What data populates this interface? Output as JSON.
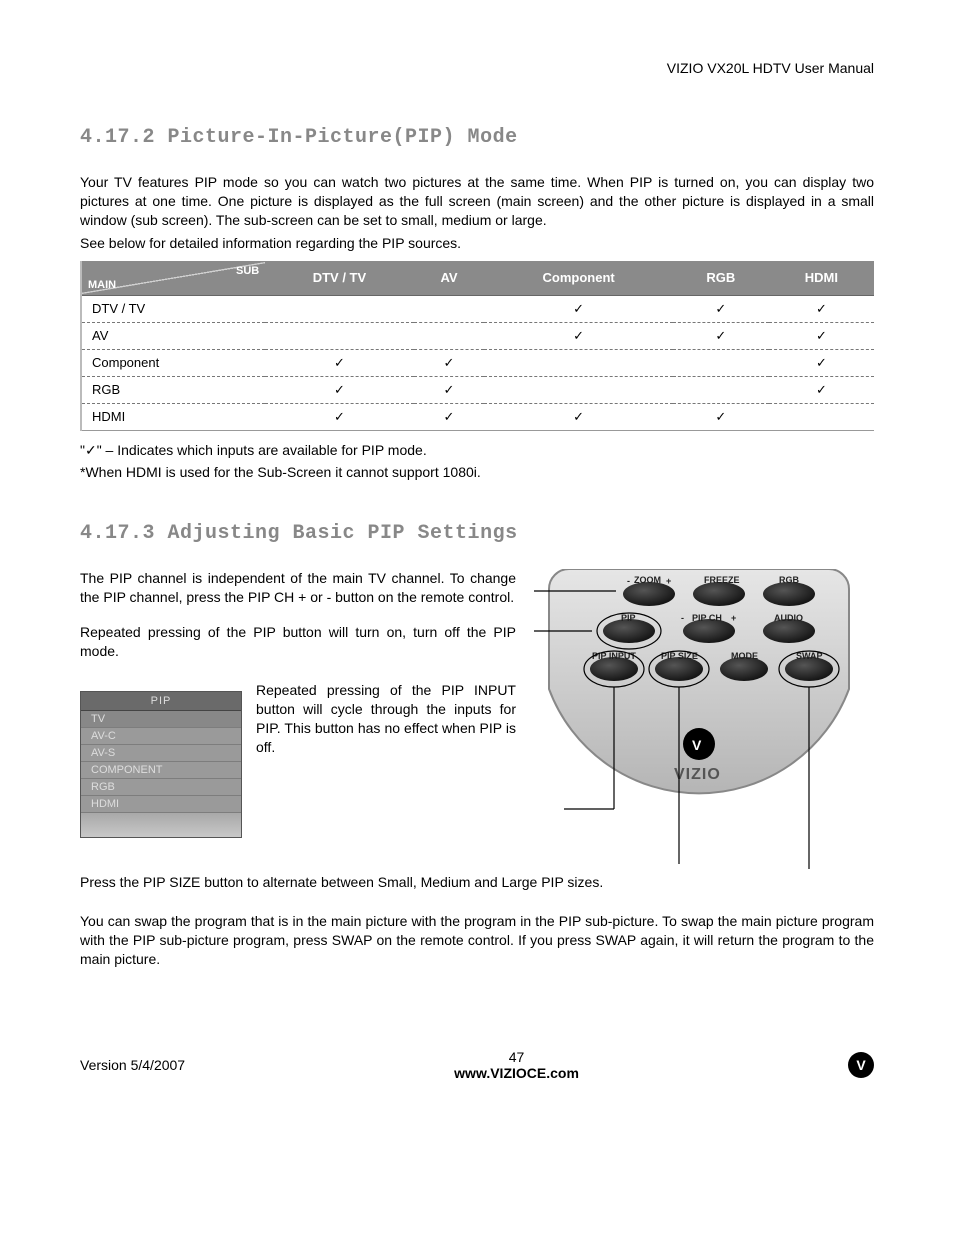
{
  "header": {
    "title": "VIZIO VX20L HDTV User Manual"
  },
  "s1": {
    "heading": "4.17.2 Picture-In-Picture(PIP) Mode",
    "p1": "Your TV features PIP mode so you can watch two pictures at the same time. When PIP is turned on, you can display two pictures at one time. One picture is displayed as the full screen (main screen) and the other picture is displayed in a small window (sub screen). The sub-screen can be set to small, medium or large.",
    "p2": "See below for detailed information regarding the PIP sources.",
    "note1": "\"✓\" – Indicates which inputs are available for PIP mode.",
    "note2": "*When HDMI is used for the Sub-Screen it cannot support 1080i."
  },
  "table": {
    "corner_sub": "SUB",
    "corner_main": "MAIN",
    "cols": [
      "DTV / TV",
      "AV",
      "Component",
      "RGB",
      "HDMI"
    ],
    "rows": [
      "DTV / TV",
      "AV",
      "Component",
      "RGB",
      "HDMI"
    ]
  },
  "chart_data": {
    "type": "table",
    "title": "PIP source compatibility (SUB columns vs MAIN rows)",
    "columns": [
      "DTV / TV",
      "AV",
      "Component",
      "RGB",
      "HDMI"
    ],
    "rows": [
      "DTV / TV",
      "AV",
      "Component",
      "RGB",
      "HDMI"
    ],
    "matrix": [
      [
        false,
        false,
        true,
        true,
        true
      ],
      [
        false,
        false,
        true,
        true,
        true
      ],
      [
        true,
        true,
        false,
        false,
        true
      ],
      [
        true,
        true,
        false,
        false,
        true
      ],
      [
        true,
        true,
        true,
        true,
        false
      ]
    ],
    "legend": "✓ indicates input is available for PIP mode"
  },
  "s2": {
    "heading": "4.17.3 Adjusting Basic PIP Settings",
    "p1": "The PIP channel is independent of the main TV channel. To change the PIP channel, press the PIP CH + or - button on the remote control.",
    "p2": "Repeated pressing of the PIP button will turn on, turn off the PIP mode.",
    "p3": "Repeated pressing of the PIP INPUT button will cycle through the inputs for PIP. This button has no effect when PIP is off.",
    "p4": "Press the PIP SIZE button to alternate between Small, Medium and Large PIP sizes.",
    "p5": "You can swap the program that is in the main picture with the program in the PIP sub-picture. To swap the main picture program with the PIP sub-picture program, press SWAP on the remote control. If you press SWAP again, it will return the program to the main picture."
  },
  "menu": {
    "title": "PIP",
    "items": [
      "TV",
      "AV-C",
      "AV-S",
      "COMPONENT",
      "RGB",
      "HDMI"
    ]
  },
  "remote": {
    "brand": "VIZIO",
    "row1": [
      "ZOOM",
      "FREEZE",
      "RGB"
    ],
    "row1_mid_prefix": "-",
    "row1_mid_suffix": "+",
    "row2": [
      "PIP",
      "PIP CH",
      "AUDIO"
    ],
    "row2_mid_prefix": "-",
    "row2_mid_suffix": "+",
    "row3": [
      "PIP INPUT",
      "PIP SIZE",
      "MODE",
      "SWAP"
    ]
  },
  "footer": {
    "version": "Version 5/4/2007",
    "page": "47",
    "url": "www.VIZIOCE.com"
  }
}
